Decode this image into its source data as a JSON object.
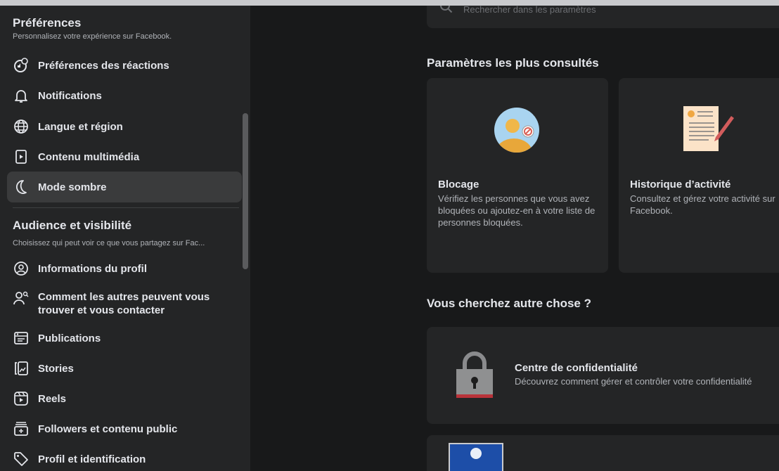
{
  "sidebar": {
    "preferences": {
      "title": "Préférences",
      "subtitle": "Personnalisez votre expérience sur Facebook.",
      "items": [
        {
          "label": "Préférences des réactions",
          "icon": "reactions-icon"
        },
        {
          "label": "Notifications",
          "icon": "bell-icon"
        },
        {
          "label": "Langue et région",
          "icon": "globe-icon"
        },
        {
          "label": "Contenu multimédia",
          "icon": "media-icon"
        },
        {
          "label": "Mode sombre",
          "icon": "moon-icon",
          "active": true
        }
      ]
    },
    "audience": {
      "title": "Audience et visibilité",
      "subtitle": "Choisissez qui peut voir ce que vous partagez sur Fac...",
      "items": [
        {
          "label": "Informations du profil",
          "icon": "profile-icon"
        },
        {
          "label": "Comment les autres peuvent vous trouver et vous contacter",
          "icon": "people-search-icon"
        },
        {
          "label": "Publications",
          "icon": "publications-icon"
        },
        {
          "label": "Stories",
          "icon": "stories-icon"
        },
        {
          "label": "Reels",
          "icon": "reels-icon"
        },
        {
          "label": "Followers et contenu public",
          "icon": "followers-icon"
        },
        {
          "label": "Profil et identification",
          "icon": "tag-icon"
        }
      ]
    }
  },
  "main": {
    "search_placeholder": "Rechercher dans les paramètres",
    "most_viewed": {
      "heading": "Paramètres les plus consultés",
      "cards": [
        {
          "title": "Blocage",
          "description": "Vérifiez les personnes que vous avez bloquées ou ajoutez-en à votre liste de personnes bloquées.",
          "icon": "blocked-user-icon"
        },
        {
          "title": "Historique d’activité",
          "description": "Consultez et gérez votre activité sur Facebook.",
          "icon": "activity-log-icon"
        }
      ]
    },
    "looking_else": {
      "heading": "Vous cherchez autre chose ?",
      "items": [
        {
          "title": "Centre de confidentialité",
          "description": "Découvrez comment gérer et contrôler votre confidentialité",
          "icon": "padlock-icon"
        }
      ]
    }
  },
  "colors": {
    "sidebar_bg": "#242526",
    "main_bg": "#18191a",
    "card_bg": "#242526",
    "active_item_bg": "#3a3b3c",
    "primary_text": "#e4e6eb",
    "secondary_text": "#b0b3b8"
  }
}
